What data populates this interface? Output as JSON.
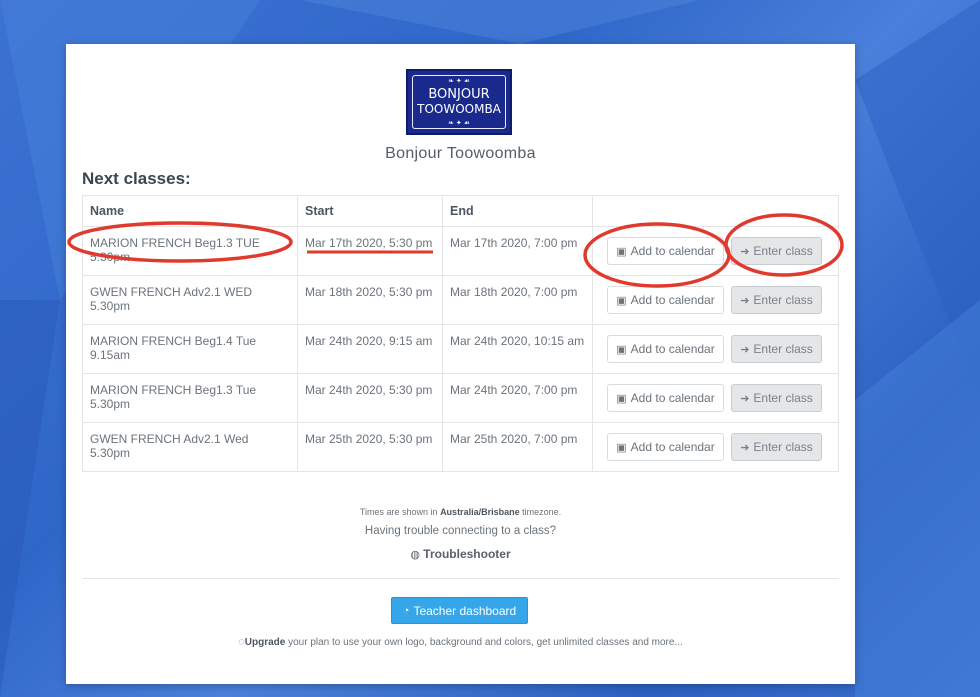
{
  "brand": {
    "logo_line1": "BONJOUR",
    "logo_line2": "TOOWOOMBA",
    "name": "Bonjour Toowoomba"
  },
  "heading": "Next classes:",
  "table": {
    "headers": [
      "Name",
      "Start",
      "End",
      ""
    ],
    "rows": [
      {
        "name": "MARION FRENCH Beg1.3 TUE 5.30pm",
        "start": "Mar 17th 2020, 5:30 pm",
        "end": "Mar 17th 2020, 7:00 pm"
      },
      {
        "name": "GWEN FRENCH Adv2.1 WED 5.30pm",
        "start": "Mar 18th 2020, 5:30 pm",
        "end": "Mar 18th 2020, 7:00 pm"
      },
      {
        "name": "MARION FRENCH Beg1.4 Tue 9.15am",
        "start": "Mar 24th 2020, 9:15 am",
        "end": "Mar 24th 2020, 10:15 am"
      },
      {
        "name": "MARION FRENCH Beg1.3 Tue 5.30pm",
        "start": "Mar 24th 2020, 5:30 pm",
        "end": "Mar 24th 2020, 7:00 pm"
      },
      {
        "name": "GWEN FRENCH Adv2.1 Wed 5.30pm",
        "start": "Mar 25th 2020, 5:30 pm",
        "end": "Mar 25th 2020, 7:00 pm"
      }
    ],
    "add_label": "Add to calendar",
    "enter_label": "Enter class"
  },
  "footer": {
    "tz_prefix": "Times are shown in",
    "tz_name": "Australia/Brisbane",
    "tz_suffix": "timezone.",
    "trouble": "Having trouble connecting to a class?",
    "troubleshooter": "Troubleshooter",
    "dashboard": "Teacher dashboard",
    "upgrade_bold": "Upgrade",
    "upgrade_rest": "your plan to use your own logo, background and colors, get unlimited classes and more..."
  },
  "colors": {
    "background": "#3169cc",
    "accent": "#35a6ea",
    "annotation": "#e03a2e",
    "logo": "#1a2a8c"
  },
  "icons": [
    "calendar-plus-icon",
    "sign-in-icon",
    "globe-icon",
    "dashboard-icon",
    "upgrade-icon"
  ]
}
